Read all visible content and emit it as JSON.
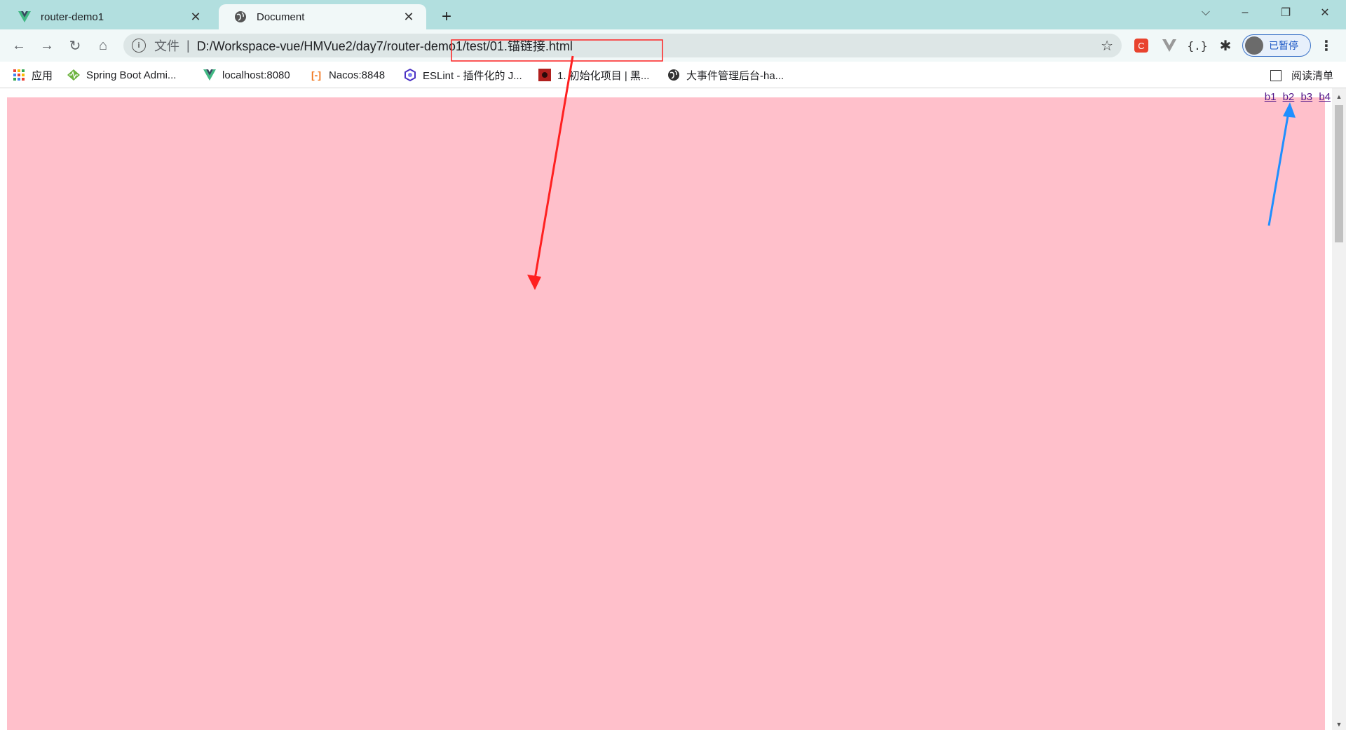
{
  "tabs": [
    {
      "title": "router-demo1",
      "icon": "vue-logo-icon"
    },
    {
      "title": "Document",
      "icon": "globe-icon"
    }
  ],
  "omnibox": {
    "scheme_label": "文件",
    "separator": "|",
    "url": "D:/Workspace-vue/HMVue2/day7/router-demo1/test/01.锚链接.html"
  },
  "profile": {
    "label": "已暂停"
  },
  "bookmarks": [
    {
      "label": "应用",
      "icon": "apps-grid-icon"
    },
    {
      "label": "Spring Boot Admi...",
      "icon": "spring-boot-admin-icon"
    },
    {
      "label": "localhost:8080",
      "icon": "vue-logo-icon"
    },
    {
      "label": "Nacos:8848",
      "icon": "nacos-icon"
    },
    {
      "label": "ESLint - 插件化的 J...",
      "icon": "eslint-icon"
    },
    {
      "label": "1. 初始化项目 | 黑...",
      "icon": "site-favicon-icon"
    },
    {
      "label": "大事件管理后台-ha...",
      "icon": "globe-icon"
    }
  ],
  "reading_list": {
    "label": "阅读清单"
  },
  "page": {
    "anchors": [
      "b1",
      "b2",
      "b3",
      "b4"
    ],
    "background": "#ffc0cb"
  },
  "annotation_colors": {
    "red": "#ff2020",
    "blue": "#1e8fff"
  }
}
